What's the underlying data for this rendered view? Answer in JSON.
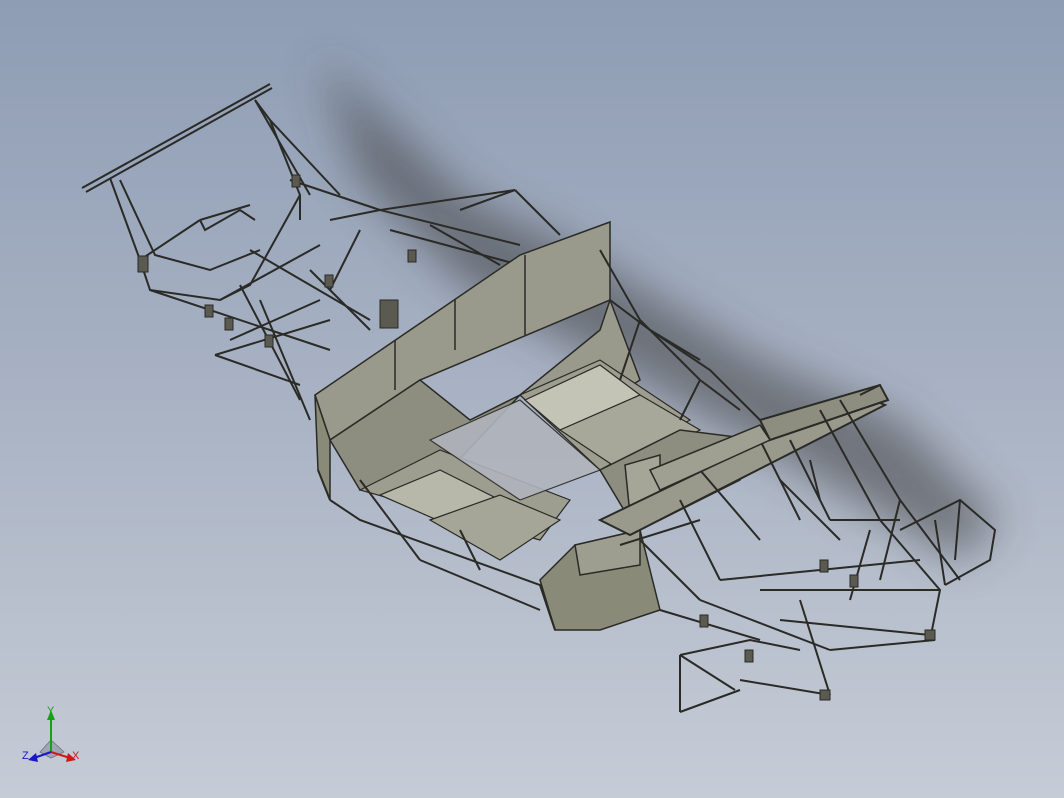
{
  "viewport": {
    "background_top": "#8e9db4",
    "background_bottom": "#c6ccd6"
  },
  "model": {
    "description_icon": "car-chassis-frame",
    "frame_color": "#8a8a78",
    "panel_color": "#9a9a8c",
    "panel_light": "#b8b8aa",
    "outline_color": "#2a2a26",
    "shadow_color": "#3c3c3c"
  },
  "triad": {
    "x_label": "X",
    "y_label": "Y",
    "z_label": "Z",
    "x_color": "#d01818",
    "y_color": "#18a018",
    "z_color": "#1818c8"
  }
}
